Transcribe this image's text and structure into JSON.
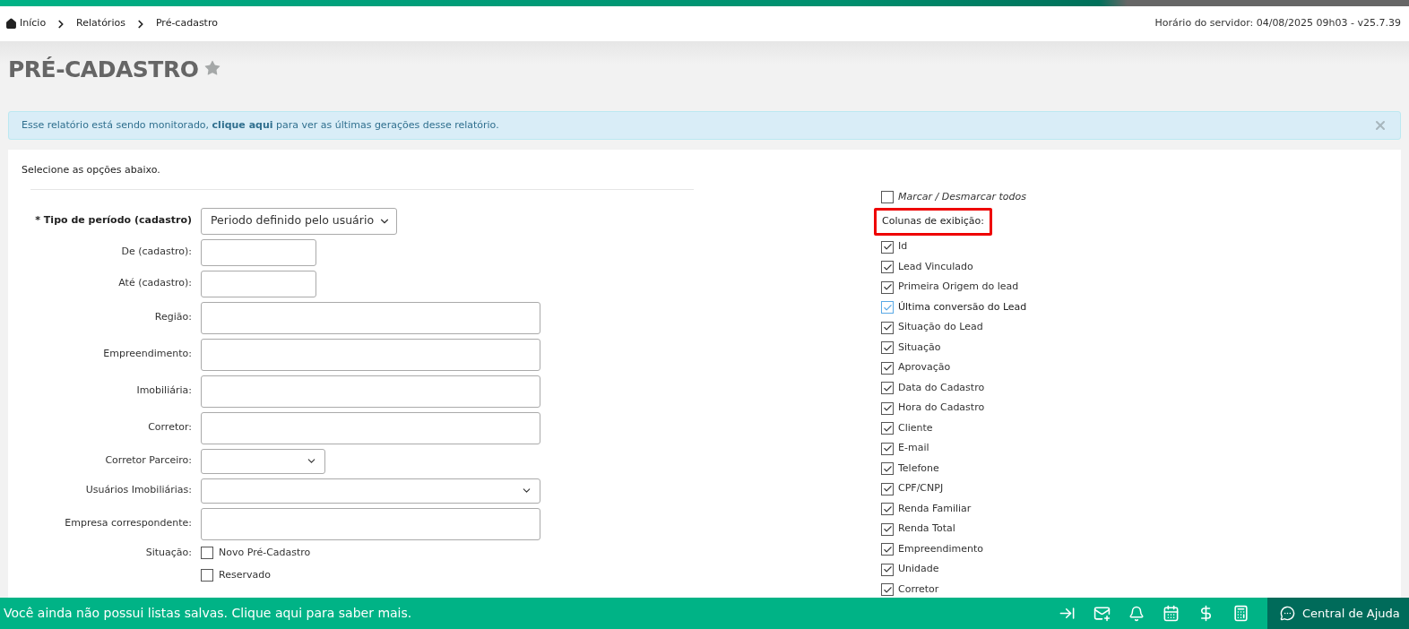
{
  "breadcrumb": [
    {
      "label": "Início",
      "kind": "home"
    },
    {
      "label": "Relatórios",
      "kind": "link"
    },
    {
      "label": "Pré-cadastro",
      "kind": "current"
    }
  ],
  "server_time": "Horário do servidor: 04/08/2025 09h03 - v25.7.39",
  "page": {
    "title": "PRÉ-CADASTRO",
    "favorite": false
  },
  "alert": {
    "before": "Esse relatório está sendo monitorado,",
    "link": "clique aqui",
    "after": "para ver as últimas gerações desse relatório."
  },
  "form": {
    "intro": "Selecione as opções abaixo.",
    "fields": [
      {
        "label": "* Tipo de período (cadastro)",
        "required": true,
        "kind": "select",
        "value": "Periodo definido pelo usuário"
      },
      {
        "label": "De (cadastro):",
        "required": false,
        "kind": "date"
      },
      {
        "label": "Até (cadastro):",
        "required": false,
        "kind": "date"
      },
      {
        "label": "Região:",
        "required": false,
        "kind": "lookup"
      },
      {
        "label": "Empreendimento:",
        "required": false,
        "kind": "lookup"
      },
      {
        "label": "Imobiliária:",
        "required": false,
        "kind": "lookup"
      },
      {
        "label": "Corretor:",
        "required": false,
        "kind": "lookup"
      },
      {
        "label": "Corretor Parceiro:",
        "required": false,
        "kind": "combo"
      },
      {
        "label": "Usuários Imobiliárias:",
        "required": false,
        "kind": "multiselect"
      },
      {
        "label": "Empresa correspondente:",
        "required": false,
        "kind": "lookup"
      },
      {
        "label": "Situação:",
        "required": false,
        "kind": "checkboxes",
        "options": [
          {
            "label": "Novo Pré-Cadastro",
            "checked": false
          },
          {
            "label": "Reservado",
            "checked": false
          }
        ]
      }
    ]
  },
  "columns": {
    "toggle_all": {
      "label": "Marcar / Desmarcar todos",
      "checked": false
    },
    "heading": {
      "label": "Colunas de exibição:",
      "highlighted": true
    },
    "items": [
      {
        "label": "Id",
        "checked": true,
        "focused": false
      },
      {
        "label": "Lead Vinculado",
        "checked": true,
        "focused": false
      },
      {
        "label": "Primeira Origem do lead",
        "checked": true,
        "focused": false
      },
      {
        "label": "Última conversão do Lead",
        "checked": true,
        "focused": true
      },
      {
        "label": "Situação do Lead",
        "checked": true,
        "focused": false
      },
      {
        "label": "Situação",
        "checked": true,
        "focused": false
      },
      {
        "label": "Aprovação",
        "checked": true,
        "focused": false
      },
      {
        "label": "Data do Cadastro",
        "checked": true,
        "focused": false
      },
      {
        "label": "Hora do Cadastro",
        "checked": true,
        "focused": false
      },
      {
        "label": "Cliente",
        "checked": true,
        "focused": false
      },
      {
        "label": "E-mail",
        "checked": true,
        "focused": false
      },
      {
        "label": "Telefone",
        "checked": true,
        "focused": false
      },
      {
        "label": "CPF/CNPJ",
        "checked": true,
        "focused": false
      },
      {
        "label": "Renda Familiar",
        "checked": true,
        "focused": false
      },
      {
        "label": "Renda Total",
        "checked": true,
        "focused": false
      },
      {
        "label": "Empreendimento",
        "checked": true,
        "focused": false
      },
      {
        "label": "Unidade",
        "checked": true,
        "focused": false
      },
      {
        "label": "Corretor",
        "checked": true,
        "focused": false
      }
    ]
  },
  "footer": {
    "message": "Você ainda não possui listas salvas. Clique aqui para saber mais.",
    "help": "Central de Ajuda"
  }
}
